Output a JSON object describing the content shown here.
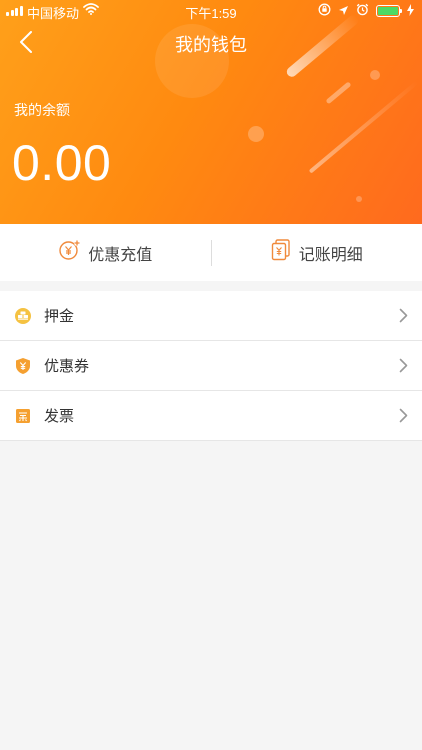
{
  "status_bar": {
    "carrier": "中国移动",
    "time": "下午1:59"
  },
  "header": {
    "title": "我的钱包",
    "balance_label": "我的余额",
    "balance_value": "0.00"
  },
  "actions": [
    {
      "label": "优惠充值",
      "icon": "coupon-recharge-icon"
    },
    {
      "label": "记账明细",
      "icon": "bill-details-icon"
    }
  ],
  "menu": [
    {
      "label": "押金",
      "icon": "deposit-icon"
    },
    {
      "label": "优惠券",
      "icon": "coupon-icon"
    },
    {
      "label": "发票",
      "icon": "invoice-icon"
    }
  ],
  "colors": {
    "header_gradient_start": "#ffa01a",
    "header_gradient_end": "#ff6a1e",
    "accent": "#ff8a10",
    "battery": "#4cd964"
  }
}
